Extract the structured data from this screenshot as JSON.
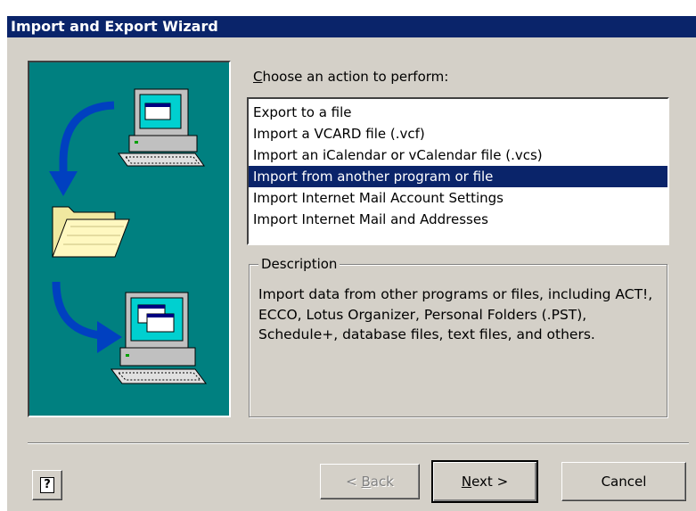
{
  "window": {
    "title": "Import and Export Wizard"
  },
  "prompt": {
    "accesskey": "C",
    "rest": "hoose an action to perform:"
  },
  "actions": {
    "items": [
      "Export to a file",
      "Import a VCARD file (.vcf)",
      "Import an iCalendar or vCalendar file (.vcs)",
      "Import from another program or file",
      "Import Internet Mail Account Settings",
      "Import Internet Mail and Addresses"
    ],
    "selected_index": 3
  },
  "description": {
    "legend": "Description",
    "text": "Import data from other programs or files, including ACT!, ECCO, Lotus Organizer, Personal Folders (.PST), Schedule+, database files, text files, and others."
  },
  "buttons": {
    "help": "?",
    "back_prefix": "< ",
    "back_key": "B",
    "back_rest": "ack",
    "next_key": "N",
    "next_rest": "ext >",
    "cancel": "Cancel"
  },
  "icons": {
    "illustration": [
      "computer-icon",
      "arrow-down-left-icon",
      "folder-icon",
      "arrow-curve-right-icon",
      "computer-icon"
    ],
    "help": "help-icon"
  },
  "colors": {
    "titlebar": "#0a246a",
    "selection": "#0a246a",
    "illustration_bg": "#008080",
    "face": "#d4d0c8"
  }
}
